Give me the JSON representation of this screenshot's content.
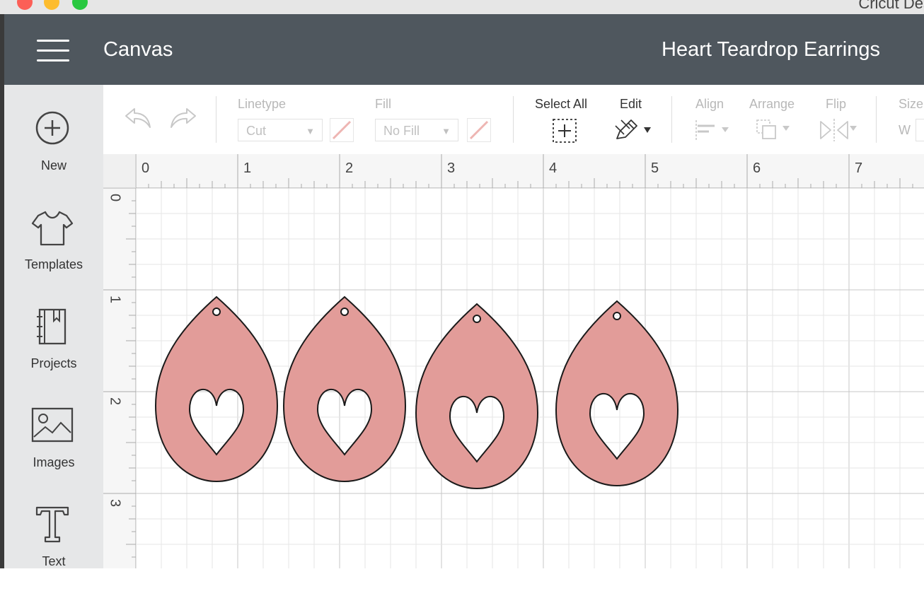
{
  "window": {
    "title_partial": "Cricut Des"
  },
  "header": {
    "menu_icon": "hamburger-menu-icon",
    "title": "Canvas",
    "project_name": "Heart Teardrop Earrings"
  },
  "sidebar": {
    "items": [
      {
        "label": "New",
        "icon": "plus-circle-icon"
      },
      {
        "label": "Templates",
        "icon": "tshirt-icon"
      },
      {
        "label": "Projects",
        "icon": "notebook-icon"
      },
      {
        "label": "Images",
        "icon": "image-icon"
      },
      {
        "label": "Text",
        "icon": "text-icon"
      }
    ]
  },
  "toolbar": {
    "undo_icon": "undo-icon",
    "redo_icon": "redo-icon",
    "linetype": {
      "label": "Linetype",
      "value": "Cut"
    },
    "fill": {
      "label": "Fill",
      "value": "No Fill"
    },
    "select_all": {
      "label": "Select All"
    },
    "edit": {
      "label": "Edit"
    },
    "align": {
      "label": "Align"
    },
    "arrange": {
      "label": "Arrange"
    },
    "flip": {
      "label": "Flip"
    },
    "size": {
      "label": "Size",
      "w_label": "W"
    }
  },
  "ruler": {
    "top_labels": [
      "0",
      "1",
      "2",
      "3",
      "4",
      "5",
      "6",
      "7"
    ],
    "left_labels": [
      "0",
      "1",
      "2",
      "3"
    ]
  },
  "canvas": {
    "fill_color": "#e29c99",
    "stroke_color": "#1a1a1a",
    "earrings": [
      {
        "name": "earring-1"
      },
      {
        "name": "earring-2"
      },
      {
        "name": "earring-3"
      },
      {
        "name": "earring-4"
      }
    ]
  }
}
